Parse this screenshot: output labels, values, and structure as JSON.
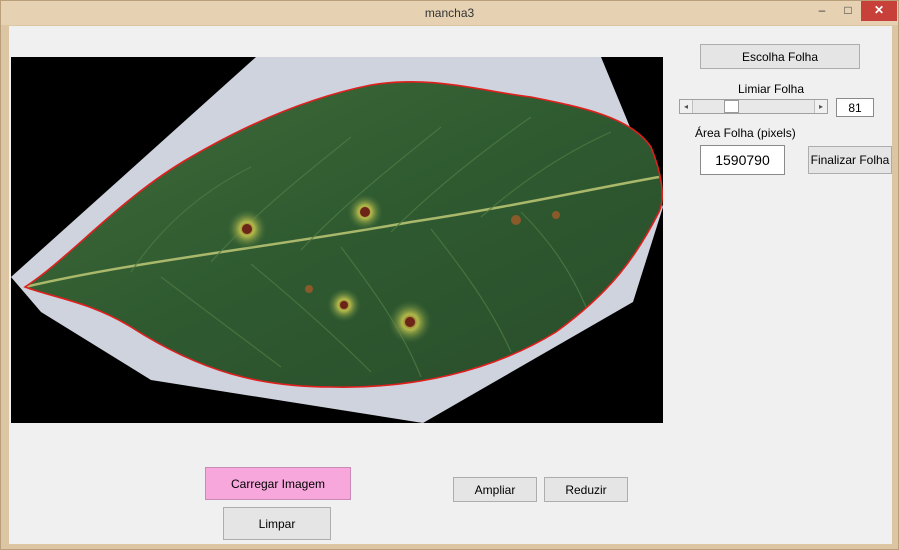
{
  "window": {
    "title": "mancha3",
    "min_glyph": "–",
    "max_glyph": "□",
    "close_glyph": "✕"
  },
  "leaf_panel": {
    "choose_button": "Escolha Folha",
    "threshold_label": "Limiar Folha",
    "threshold_value": "81",
    "threshold_level": 81,
    "area_label": "Área Folha (pixels)",
    "area_value": "1590790",
    "finish_button": "Finalizar Folha"
  },
  "actions": {
    "load_button": "Carregar Imagem",
    "clear_button": "Limpar",
    "zoom_in_button": "Ampliar",
    "zoom_out_button": "Reduzir"
  },
  "colors": {
    "load_button_bg": "#f7a7dc",
    "leaf_outline": "#e0201e",
    "close_button": "#c7403a"
  }
}
